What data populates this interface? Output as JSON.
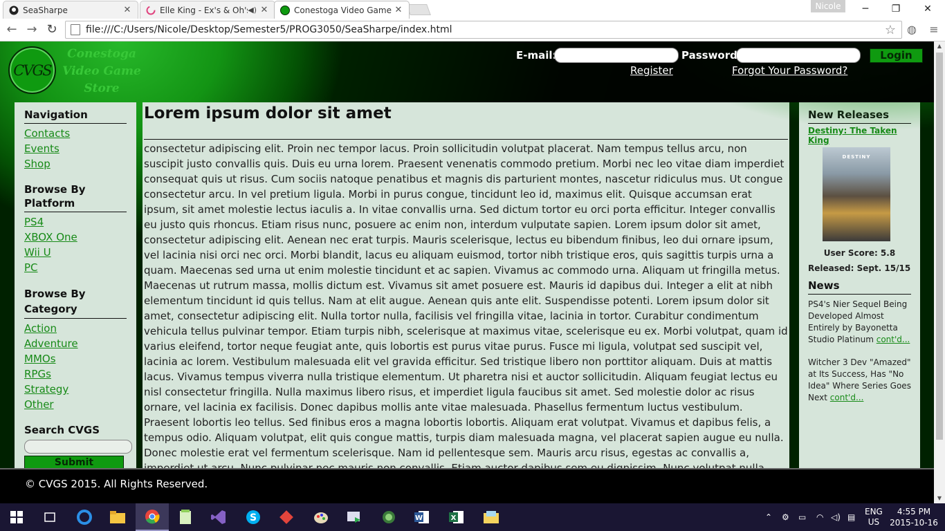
{
  "browser": {
    "tabs": [
      {
        "title": "SeaSharpe",
        "active": false,
        "icon": "github-icon"
      },
      {
        "title": "Elle King - Ex's & Oh's",
        "active": false,
        "icon": "youtube-loading-icon",
        "audio": true
      },
      {
        "title": "Conestoga Video Game St",
        "active": true,
        "icon": "cvgs-icon"
      }
    ],
    "profile_name": "Nicole",
    "url": "file:///C:/Users/Nicole/Desktop/Semester5/PROG3050/SeaSharpe/index.html"
  },
  "site": {
    "logo_text": "CVGS",
    "title_lines": [
      "Conestoga",
      "Video Game",
      "Store"
    ],
    "login": {
      "email_label": "E-mail:",
      "password_label": "Password:",
      "login_button": "Login",
      "register_link": "Register",
      "forgot_link": "Forgot Your Password?"
    },
    "left": {
      "navigation": {
        "heading": "Navigation",
        "items": [
          "Contacts",
          "Events",
          "Shop"
        ]
      },
      "platform": {
        "heading": "Browse By Platform",
        "items": [
          "PS4",
          "XBOX One",
          "Wii U",
          "PC"
        ]
      },
      "category": {
        "heading": "Browse By Category",
        "items": [
          "Action",
          "Adventure",
          "MMOs",
          "RPGs",
          "Strategy",
          "Other"
        ]
      },
      "search": {
        "heading": "Search CVGS",
        "submit": "Submit"
      }
    },
    "main": {
      "title": "Lorem ipsum dolor sit amet",
      "body": "consectetur adipiscing elit. Proin nec tempor lacus. Proin sollicitudin volutpat placerat. Nam tempus tellus arcu, non suscipit justo convallis quis. Duis eu urna lorem. Praesent venenatis commodo pretium. Morbi nec leo vitae diam imperdiet consequat quis ut risus. Cum sociis natoque penatibus et magnis dis parturient montes, nascetur ridiculus mus. Ut congue consectetur arcu. In vel pretium ligula. Morbi in purus congue, tincidunt leo id, maximus elit. Quisque accumsan erat ipsum, sit amet molestie lectus iaculis a. In vitae convallis urna. Sed dictum tortor eu orci porta efficitur. Integer convallis eu justo quis rhoncus. Etiam risus nunc, posuere ac enim non, interdum vulputate sapien. Lorem ipsum dolor sit amet, consectetur adipiscing elit. Aenean nec erat turpis. Mauris scelerisque, lectus eu bibendum finibus, leo dui ornare ipsum, vel lacinia nisi orci nec orci. Morbi blandit, lacus eu aliquam euismod, tortor nibh tristique eros, quis sagittis turpis urna a quam. Maecenas sed urna ut enim molestie tincidunt et ac sapien. Vivamus ac commodo urna. Aliquam ut fringilla metus. Maecenas ut rutrum massa, mollis dictum est. Vivamus sit amet posuere est. Mauris id dapibus dui. Integer a elit at nibh elementum tincidunt id quis tellus. Nam at elit augue. Aenean quis ante elit. Suspendisse potenti. Lorem ipsum dolor sit amet, consectetur adipiscing elit. Nulla tortor nulla, facilisis vel fringilla vitae, lacinia in tortor. Curabitur condimentum vehicula tellus pulvinar tempor. Etiam turpis nibh, scelerisque at maximus vitae, scelerisque eu ex. Morbi volutpat, quam id varius eleifend, tortor neque feugiat ante, quis lobortis est purus vitae purus. Fusce mi ligula, volutpat sed suscipit vel, lacinia ac lorem. Vestibulum malesuada elit vel gravida efficitur. Sed tristique libero non porttitor aliquam. Duis at mattis lacus. Vivamus tempus viverra nulla tristique elementum. Ut pharetra nisi et auctor sollicitudin. Aliquam feugiat lectus eu nisl consectetur fringilla. Nulla maximus libero risus, et imperdiet ligula faucibus sit amet. Sed molestie dolor ac risus ornare, vel lacinia ex facilisis. Donec dapibus mollis ante vitae malesuada. Phasellus fermentum luctus vestibulum. Praesent lobortis leo tellus. Sed finibus eros a magna lobortis lobortis. Aliquam erat volutpat. Vivamus et dapibus felis, a tempus odio. Aliquam volutpat, elit quis congue mattis, turpis diam malesuada magna, vel placerat sapien augue eu nulla. Donec molestie erat vel fermentum scelerisque. Nam id pellentesque sem. Mauris arcu risus, egestas ac convallis a, imperdiet ut arcu. Nunc pulvinar nec mauris non convallis. Etiam auctor dapibus sem eu dignissim. Nunc volutpat nulla eleifend consectetur metus pellentesque fermentum. Donec commodo, dui vel suscipit scelerisque"
    },
    "right": {
      "releases_heading": "New Releases",
      "release": {
        "title": "Destiny: The Taken King",
        "cover_text": "DESTINY",
        "score": "User Score: 5.8",
        "released": "Released: Sept. 15/15"
      },
      "news_heading": "News",
      "news": [
        {
          "text": "PS4's Nier Sequel Being Developed Almost Entirely by Bayonetta Studio Platinum",
          "link": "cont'd..."
        },
        {
          "text": "Witcher 3 Dev \"Amazed\" at Its Success, Has \"No Idea\" Where Series Goes Next",
          "link": "cont'd..."
        }
      ]
    },
    "footer": "© CVGS 2015. All Rights Reserved."
  },
  "taskbar": {
    "apps": [
      "start-icon",
      "task-view-icon",
      "edge-icon",
      "file-explorer-icon",
      "chrome-icon",
      "notepad-plus-plus-icon",
      "visual-studio-icon",
      "skype-icon",
      "git-icon",
      "paint-icon",
      "media-icon",
      "android-icon",
      "word-icon",
      "excel-icon",
      "folder-icon"
    ],
    "lang": "ENG",
    "region": "US",
    "time": "4:55 PM",
    "date": "2015-10-16"
  },
  "colors": {
    "accent_green": "#0f9a10",
    "link_green": "#178a17",
    "panel_bg": "#d6e5da",
    "taskbar_bg": "#1a1633"
  }
}
